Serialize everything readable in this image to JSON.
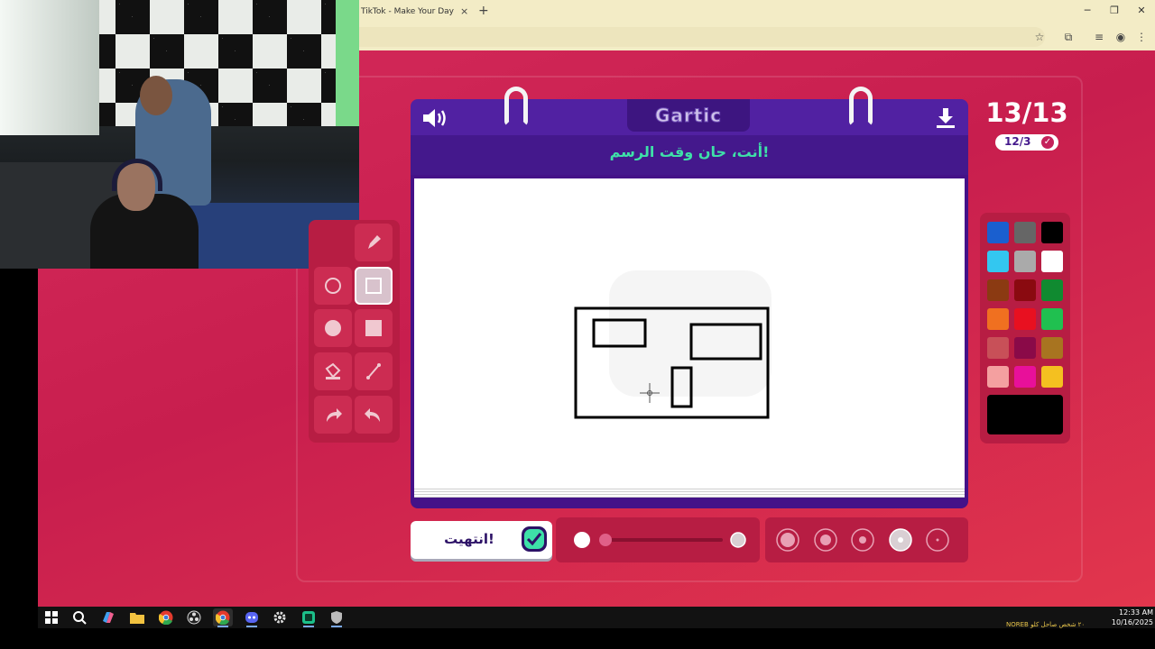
{
  "browser": {
    "tab_title": "TikTok - Make Your Day",
    "tab_close": "×",
    "new_tab": "+",
    "minimize": "─",
    "restore": "❐",
    "close": "✕"
  },
  "game": {
    "logo": "Gartic",
    "prompt": "أنت، حان وقت الرسم!",
    "round": "13/13",
    "players": "12/3",
    "done_label": "انتهيت!"
  },
  "palette": {
    "colors": [
      "#1a5fcf",
      "#666666",
      "#000000",
      "#33c7f0",
      "#aaaaaa",
      "#ffffff",
      "#8b3a12",
      "#8a0a10",
      "#108a30",
      "#f07020",
      "#e81020",
      "#20c050",
      "#c85058",
      "#8a0a48",
      "#a87420",
      "#f4a0a0",
      "#e8109a",
      "#f4c020"
    ],
    "current": "#000000"
  },
  "taskbar": {
    "time": "12:33 AM",
    "date": "10/16/2025",
    "tray_text": "NOREB ٢٠ شخص صاحل كلو"
  }
}
